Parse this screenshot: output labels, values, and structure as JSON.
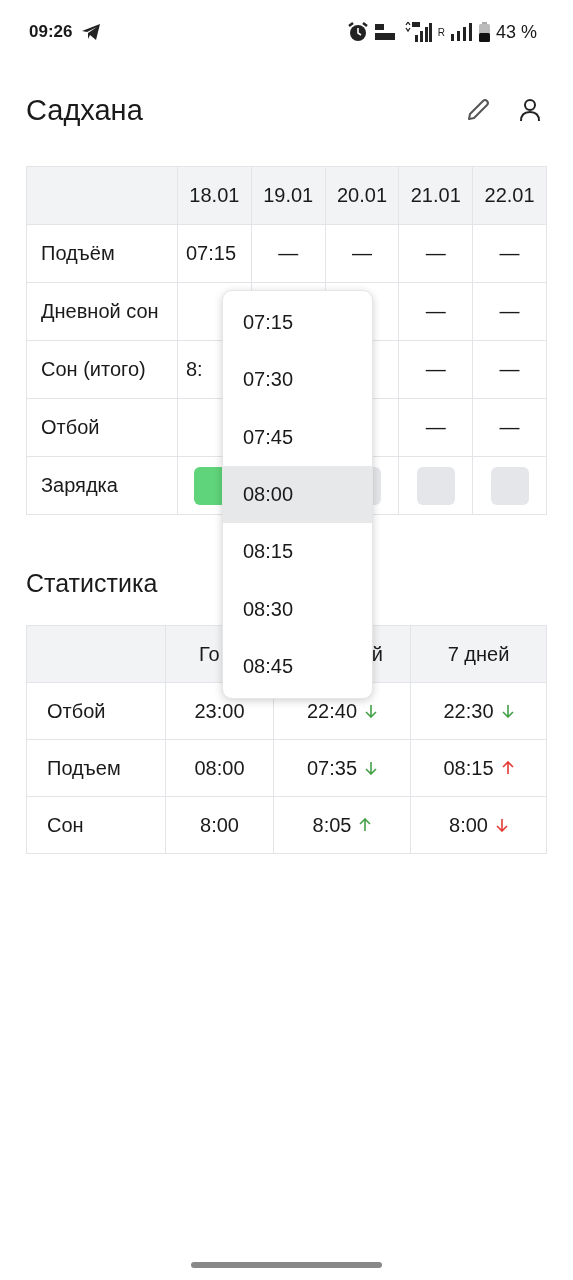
{
  "status_bar": {
    "time": "09:26",
    "network": "R",
    "battery": "43 %"
  },
  "header": {
    "title": "Садхана"
  },
  "schedule": {
    "dates": [
      "18.01",
      "19.01",
      "20.01",
      "21.01",
      "22.01"
    ],
    "rows": [
      {
        "kind": "text",
        "label": "Подъём",
        "cells": [
          "07:15",
          "—",
          "—",
          "—",
          "—"
        ]
      },
      {
        "kind": "text",
        "label": "Дневной сон",
        "cells": [
          null,
          null,
          null,
          "—",
          "—"
        ]
      },
      {
        "kind": "text",
        "label": "Сон (итого)",
        "cells": [
          "8:",
          null,
          null,
          "—",
          "—"
        ]
      },
      {
        "kind": "text",
        "label": "Отбой",
        "cells": [
          null,
          null,
          null,
          "—",
          "—"
        ]
      },
      {
        "kind": "check",
        "label": "Зарядка",
        "cells": [
          {
            "checked": true
          },
          null,
          {
            "checked": false
          },
          {
            "checked": false
          },
          {
            "checked": false
          }
        ]
      }
    ]
  },
  "stats": {
    "title": "Статистика",
    "columns": [
      "Го",
      "й",
      "7 дней"
    ],
    "rows": [
      {
        "label": "Отбой",
        "values": [
          {
            "text": "23:00"
          },
          {
            "text": "22:40",
            "rising": false,
            "color": "#43a047"
          },
          {
            "text": "22:30",
            "rising": false,
            "color": "#43a047"
          }
        ]
      },
      {
        "label": "Подъем",
        "values": [
          {
            "text": "08:00"
          },
          {
            "text": "07:35",
            "rising": false,
            "color": "#43a047"
          },
          {
            "text": "08:15",
            "rising": true,
            "color": "#e53935"
          }
        ]
      },
      {
        "label": "Сон",
        "values": [
          {
            "text": "8:00"
          },
          {
            "text": "8:05",
            "rising": true,
            "color": "#43a047"
          },
          {
            "text": "8:00",
            "rising": false,
            "color": "#e53935"
          }
        ]
      }
    ]
  },
  "time_menu": {
    "options": [
      {
        "label": "07:15",
        "selected": false
      },
      {
        "label": "07:30",
        "selected": false
      },
      {
        "label": "07:45",
        "selected": false
      },
      {
        "label": "08:00",
        "selected": true
      },
      {
        "label": "08:15",
        "selected": false
      },
      {
        "label": "08:30",
        "selected": false
      },
      {
        "label": "08:45",
        "selected": false
      }
    ]
  }
}
